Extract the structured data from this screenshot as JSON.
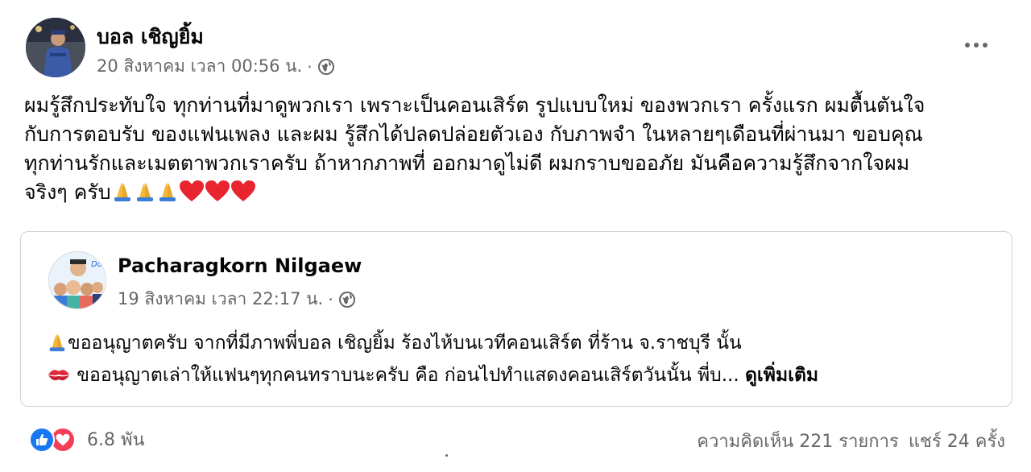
{
  "post": {
    "author": "บอล เชิญยิ้ม",
    "timestamp": "20 สิงหาคม เวลา 00:56 น.",
    "meta_separator": "·",
    "privacy_icon": "globe-icon",
    "more_icon": "more-horizontal-icon",
    "text_lines": [
      "ผมรู้สึกประทับใจ ทุกท่านที่มาดูพวกเรา เพราะเป็นคอนเสิร์ต รูปแบบใหม่ ของพวกเรา ครั้งแรก ผมตื้นตันใจ",
      "กับการตอบรับ ของแฟนเพลง และผม รู้สึกได้ปลดปล่อยตัวเอง กับภาพจำ ในหลายๆเดือนที่ผ่านมา ขอบคุณ",
      "ทุกท่านรักและเมตตาพวกเราครับ ถ้าหากภาพที่ ออกมาดูไม่ดี ผมกราบขออภัย มันคือความรู้สึกจากใจผม",
      "จริงๆ ครับ"
    ],
    "trailing_emojis": [
      "pray",
      "pray",
      "pray",
      "heart",
      "heart",
      "heart"
    ]
  },
  "shared": {
    "author": "Pacharagkorn Nilgaew",
    "avatar_badge": "Don",
    "timestamp": "19 สิงหาคม เวลา 22:17 น.",
    "meta_separator": "·",
    "privacy_icon": "globe-icon",
    "line1": "ขออนุญาตครับ จากที่มีภาพพี่บอล เชิญยิ้ม ร้องไห้บนเวทีคอนเสิร์ต ที่ร้าน จ.ราชบุรี นั้น",
    "line2": " ขออนุญาตเล่าให้แฟนๆทุกคนทราบนะครับ คือ ก่อนไปทำแสดงคอนเสิร์ตวันนั้น พี่บ... ",
    "see_more": "ดูเพิ่มเติม",
    "line1_icon": "pray-icon",
    "line2_icon": "kiss-mark-icon"
  },
  "footer": {
    "reaction_count": "6.8 พัน",
    "reaction_icons": [
      "like-icon",
      "love-icon"
    ],
    "comments": "ความคิดเห็น 221 รายการ",
    "shares": "แชร์ 24 ครั้ง"
  },
  "colors": {
    "text_primary": "#050505",
    "text_secondary": "#65676b",
    "like_blue": "#1877f2",
    "love_red": "#f33e58",
    "card_border": "#ced0d4"
  }
}
